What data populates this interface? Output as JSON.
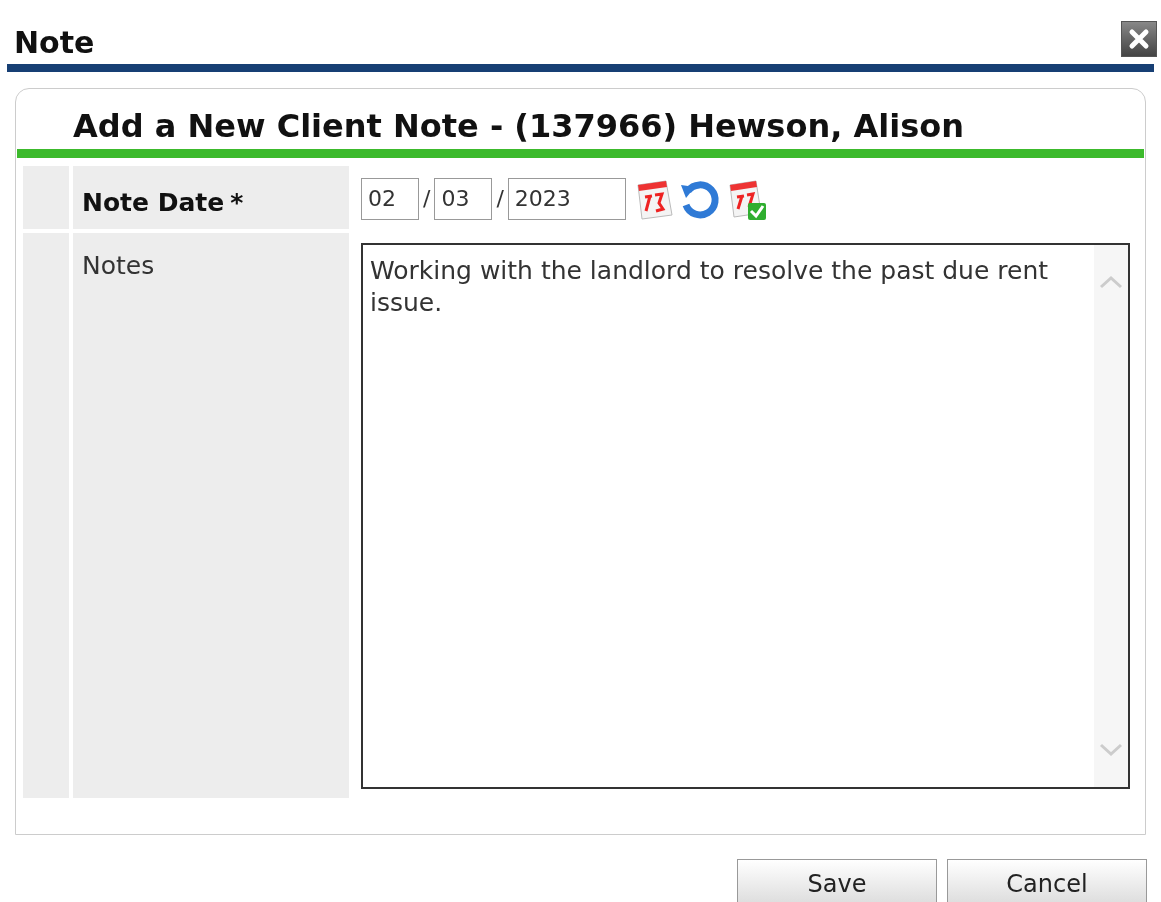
{
  "dialog": {
    "title": "Note"
  },
  "form": {
    "heading": "Add a New Client Note - (137966) Hewson, Alison",
    "fields": [
      {
        "kind": "date",
        "label": "Note Date",
        "required_mark": "*",
        "parts": [
          "02",
          "03",
          "2023"
        ],
        "separators": [
          "/",
          "/"
        ]
      },
      {
        "kind": "textarea",
        "label": "Notes",
        "value": "Working with the landlord to resolve the past due rent issue. "
      }
    ]
  },
  "buttons": [
    {
      "label": "Save"
    },
    {
      "label": "Cancel"
    }
  ]
}
